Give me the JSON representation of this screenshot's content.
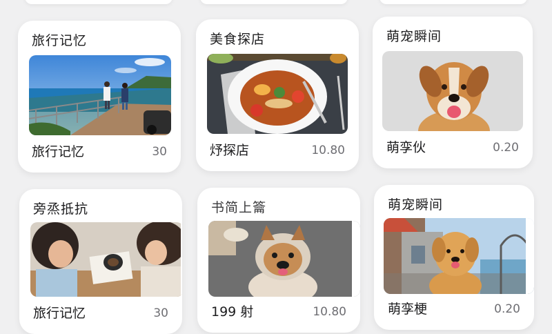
{
  "cards": [
    {
      "title": "旅行记忆",
      "label": "旅行记忆",
      "value": "30",
      "image_icon": "coastal-walkway-photo"
    },
    {
      "title": "美食探店",
      "label": "㶦探店",
      "value": "10.80",
      "image_icon": "food-bowl-photo"
    },
    {
      "title": "萌宠瞬间",
      "label": "萌孪伙",
      "value": "0.20",
      "image_icon": "dog-photo"
    },
    {
      "title": "旁烝抵抗",
      "label": "旅行记忆",
      "value": "30",
      "image_icon": "cafe-women-photo"
    },
    {
      "title": "书简上籥",
      "label": "199 射",
      "value": "10.80",
      "image_icon": "pug-dog-photo"
    },
    {
      "title": "萌宠瞬间",
      "label": "萌孪梗",
      "value": "0.20",
      "image_icon": "golden-dog-photo"
    }
  ]
}
